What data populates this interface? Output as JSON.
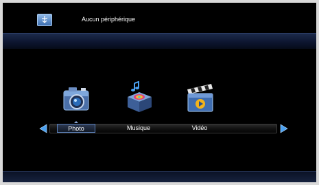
{
  "header": {
    "device_status": "Aucun périphérique",
    "device_icon": "usb-storage-icon"
  },
  "menu": {
    "items": [
      {
        "label": "Photo",
        "icon": "camera-icon",
        "selected": true
      },
      {
        "label": "Musique",
        "icon": "music-box-icon",
        "selected": false
      },
      {
        "label": "Vidéo",
        "icon": "clapperboard-icon",
        "selected": false
      }
    ],
    "left_arrow_icon": "arrow-left-icon",
    "right_arrow_icon": "arrow-right-icon"
  },
  "colors": {
    "accent": "#4aa0f0",
    "band": "#0d1630",
    "background": "#000000"
  }
}
